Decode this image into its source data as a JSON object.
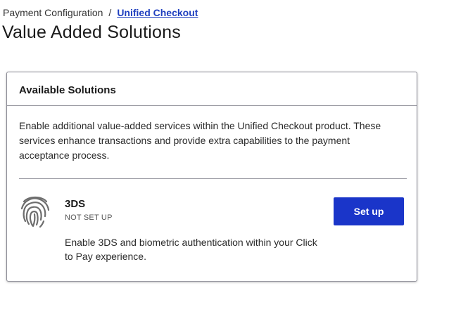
{
  "breadcrumb": {
    "parent": "Payment Configuration",
    "separator": "/",
    "current": "Unified Checkout"
  },
  "page": {
    "title": "Value Added Solutions"
  },
  "card": {
    "header": "Available Solutions",
    "description": "Enable additional value-added services within the Unified Checkout product. These services enhance transactions and provide extra capabilities to the payment acceptance process.",
    "solutions": [
      {
        "icon": "fingerprint-icon",
        "name": "3DS",
        "status": "NOT SET UP",
        "description": "Enable 3DS and biometric authentication within your Click to Pay experience.",
        "action_label": "Set up"
      }
    ]
  },
  "colors": {
    "link": "#1f3fbf",
    "primary_button": "#1a35c9",
    "border": "#8c8c96"
  }
}
